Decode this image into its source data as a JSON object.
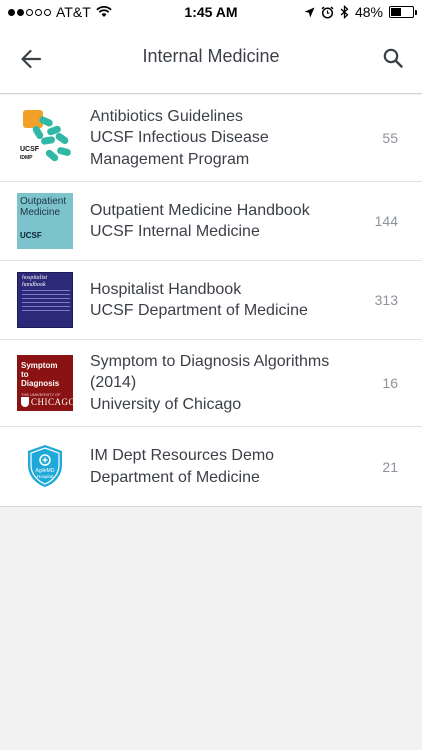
{
  "status_bar": {
    "carrier": "AT&T",
    "time": "1:45 AM",
    "battery": "48%",
    "battery_level": 0.48,
    "signal_bars_filled": 2,
    "signal_bars_total": 5
  },
  "nav": {
    "title": "Internal Medicine"
  },
  "items": [
    {
      "lines": [
        "Antibiotics Guidelines",
        "UCSF Infectious Disease",
        "Management Program"
      ],
      "count": "55",
      "thumb_text": [
        "UCSF",
        "IDMP"
      ]
    },
    {
      "lines": [
        "Outpatient Medicine Handbook",
        "UCSF Internal Medicine"
      ],
      "count": "144",
      "thumb_text": [
        "Outpatient",
        "Medicine",
        "UCSF"
      ]
    },
    {
      "lines": [
        "Hospitalist Handbook",
        "UCSF Department of Medicine"
      ],
      "count": "313",
      "thumb_text": [
        "hospitalist",
        "handbook"
      ]
    },
    {
      "lines": [
        "Symptom to Diagnosis Algorithms",
        "(2014)",
        "University of Chicago"
      ],
      "count": "16",
      "thumb_text": [
        "Symptom",
        "to",
        "Diagnosis",
        "THE UNIVERSITY OF",
        "CHICAGO"
      ]
    },
    {
      "lines": [
        "IM Dept Resources Demo",
        "Department of Medicine"
      ],
      "count": "21",
      "thumb_text": [
        "AgileMD",
        "Hospital"
      ]
    }
  ],
  "colors": {
    "text": "#3b3f46",
    "count": "#8e9299",
    "background": "#f2f2f2",
    "agilemd_shield": "#1fa9d8"
  }
}
